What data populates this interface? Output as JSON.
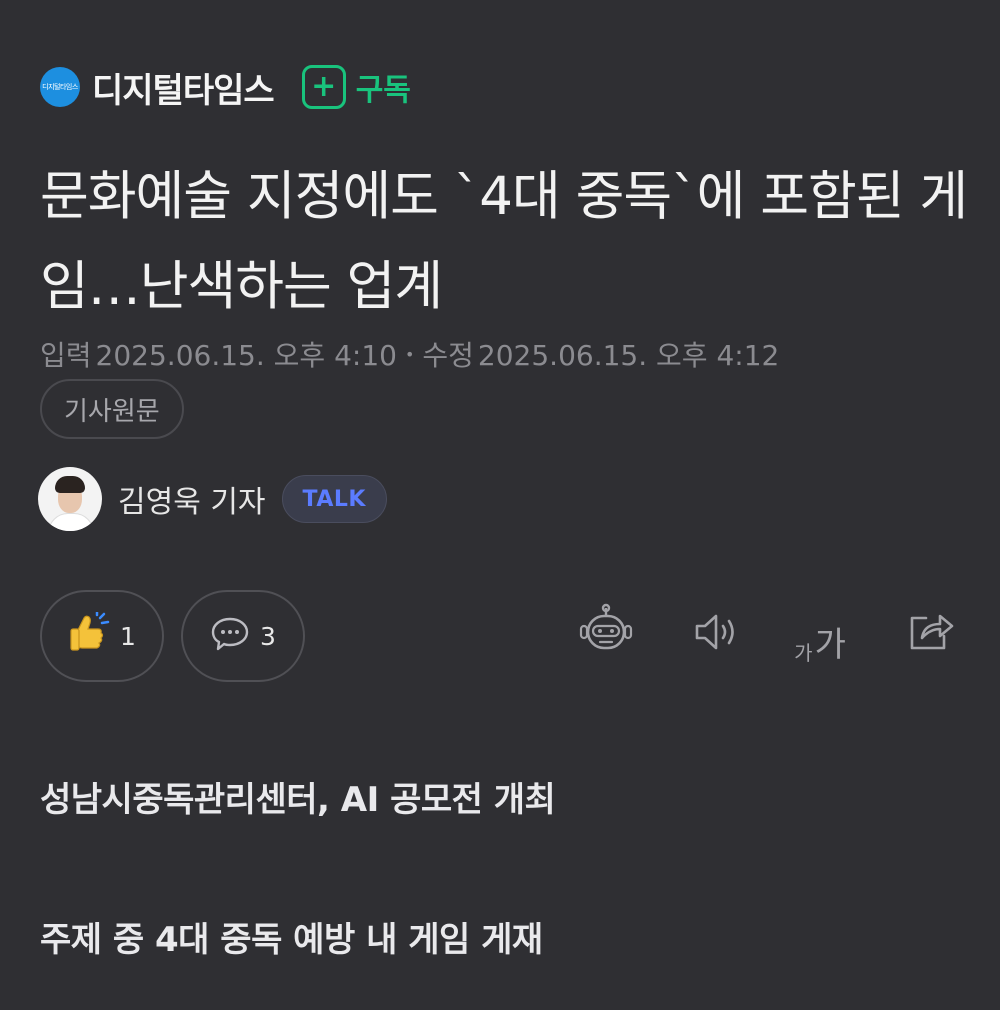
{
  "press": {
    "logo_text": "디지털타임스",
    "name": "디지털타임스",
    "subscribe_icon": "+",
    "subscribe_label": "구독"
  },
  "article": {
    "headline": "문화예술 지정에도 `4대 중독`에 포함된 게임…난색하는 업계",
    "input_label": "입력",
    "input_time": "2025.06.15. 오후 4:10",
    "modified_label": "수정",
    "modified_time": "2025.06.15. 오후 4:12",
    "original_button": "기사원문"
  },
  "reporter": {
    "name": "김영욱 기자",
    "talk_label": "TALK"
  },
  "actions": {
    "like_count": "1",
    "comment_count": "3",
    "font_small": "가",
    "font_big": "가"
  },
  "body": {
    "subheading_1": "성남시중독관리센터, AI 공모전 개최",
    "subheading_2": "주제 중 4대 중독 예방 내 게임 게재"
  },
  "colors": {
    "background": "#2f2f33",
    "accent_green": "#19c37d",
    "talk_blue": "#5b7cff",
    "press_blue": "#1d8fe0",
    "meta_gray": "#8b8b90"
  },
  "icons": {
    "like": "thumbs-up-icon",
    "comment": "speech-bubble-icon",
    "summary": "robot-icon",
    "audio": "speaker-icon",
    "font": "font-size-icon",
    "share": "share-icon"
  }
}
